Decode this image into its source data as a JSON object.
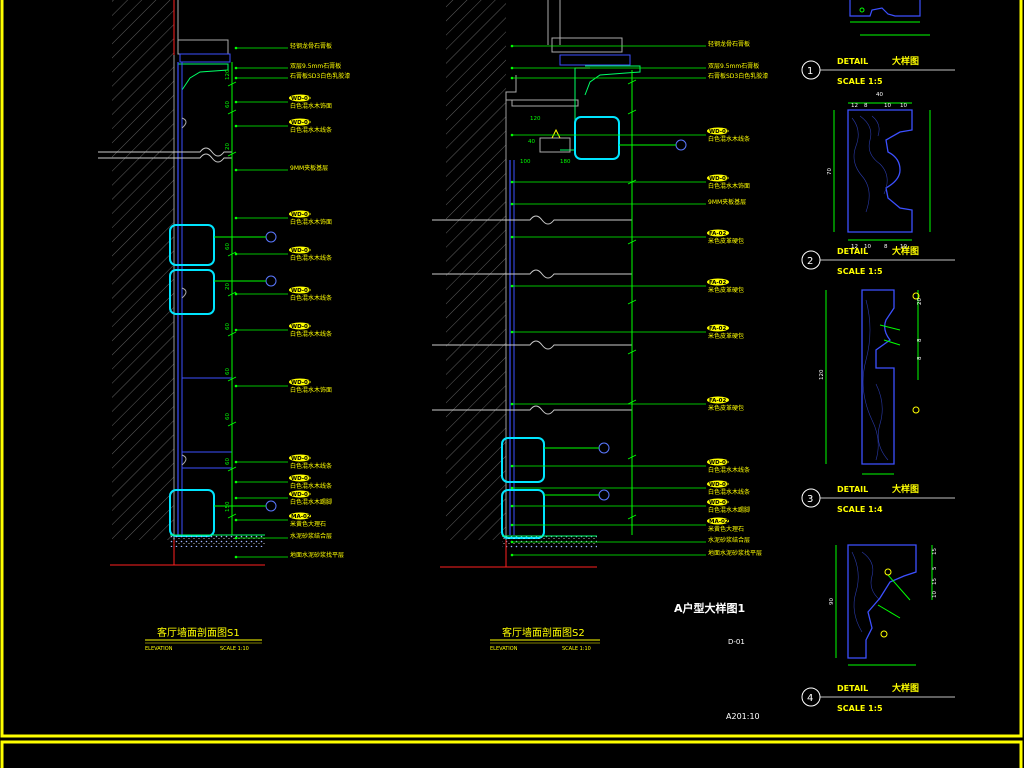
{
  "colors": {
    "frame": "#ffff00",
    "wall_hatch": "#9a9a9a",
    "leader": "#00ff00",
    "dimension": "#00ff00",
    "panel_line": "#3c50ff",
    "highlight_box": "#00e5ff",
    "callout_fill": "#ffff00",
    "label_text": "#ffff00",
    "title_text": "#ffff00",
    "note_text": "#ffffff",
    "floor_line": "#ff2020",
    "detail_circle": "#ffffff"
  },
  "section1": {
    "title": "客厅墙面剖面图S1",
    "elevation_label": "ELEVATION",
    "scale_label": "SCALE 1:10",
    "notes": [
      {
        "text": "轻钢龙骨石膏板"
      },
      {
        "text": "双层9.5mm石膏板"
      },
      {
        "text": "石膏板SD3白色乳胶漆"
      },
      {
        "tag": "WD-01",
        "text": "白色混水木饰面"
      },
      {
        "tag": "WD-01",
        "text": "白色混水木线条"
      },
      {
        "text": "9MM夹板基层"
      },
      {
        "tag": "WD-01",
        "text": "白色混水木饰面"
      },
      {
        "tag": "WD-01",
        "text": "白色混水木线条"
      },
      {
        "tag": "WD-01",
        "text": "白色混水木线条"
      },
      {
        "tag": "WD-01",
        "text": "白色混水木线条"
      },
      {
        "tag": "WD-01",
        "text": "白色混水木饰面"
      },
      {
        "tag": "WD-01",
        "text": "白色混水木线条"
      },
      {
        "tag": "WD-01",
        "text": "白色混水木线条"
      },
      {
        "tag": "WD-01",
        "text": "白色混水木踢脚"
      },
      {
        "tag": "MA-02",
        "text": "米黄色大理石"
      },
      {
        "text": "水泥砂浆结合层"
      },
      {
        "text": "地面水泥砂浆找平层"
      }
    ],
    "dims": [
      "120",
      "60",
      "20",
      "60",
      "20",
      "60",
      "60",
      "60",
      "60",
      "150"
    ]
  },
  "section2": {
    "title": "客厅墙面剖面图S2",
    "elevation_label": "ELEVATION",
    "scale_label": "SCALE 1:10",
    "notes": [
      {
        "text": "轻钢龙骨石膏板"
      },
      {
        "text": "双层9.5mm石膏板"
      },
      {
        "text": "石膏板SD3白色乳胶漆"
      },
      {
        "tag": "WD-01",
        "text": "白色混水木线条"
      },
      {
        "tag": "WD-01",
        "text": "白色混水木饰面"
      },
      {
        "text": "9MM夹板基层"
      },
      {
        "tag": "FA-02",
        "text": "米色皮革硬包"
      },
      {
        "tag": "FA-02",
        "text": "米色皮革硬包"
      },
      {
        "tag": "FA-02",
        "text": "米色皮革硬包"
      },
      {
        "tag": "FA-02",
        "text": "米色皮革硬包"
      },
      {
        "tag": "WD-01",
        "text": "白色混水木线条"
      },
      {
        "tag": "WD-01",
        "text": "白色混水木线条"
      },
      {
        "tag": "WD-01",
        "text": "白色混水木踢脚"
      },
      {
        "tag": "MA-02",
        "text": "米黄色大理石"
      },
      {
        "text": "水泥砂浆结合层"
      },
      {
        "text": "地面水泥砂浆找平层"
      }
    ],
    "dims_top": [
      "100",
      "180",
      "120",
      "40"
    ]
  },
  "sheet": {
    "title": "A户型大样图1",
    "sheet_no": "D-01",
    "drawing_no": "A201:10"
  },
  "details": [
    {
      "number": "1",
      "label": "DETAIL",
      "cn": "大样图",
      "scale": "SCALE 1:5"
    },
    {
      "number": "2",
      "label": "DETAIL",
      "cn": "大样图",
      "scale": "SCALE 1:5"
    },
    {
      "number": "3",
      "label": "DETAIL",
      "cn": "大样图",
      "scale": "SCALE 1:4"
    },
    {
      "number": "4",
      "label": "DETAIL",
      "cn": "大样图",
      "scale": "SCALE 1:5"
    }
  ],
  "detail_dims": {
    "d1_top": [
      "12",
      "8",
      "10",
      "10"
    ],
    "d1_top_total": "40",
    "d1_bottom": [
      "12",
      "10",
      "8",
      "10"
    ],
    "d1_left": "70",
    "d2_right": [
      "20",
      "8",
      "8"
    ],
    "d2_left": "120",
    "d3_right": [
      "15",
      "5",
      "15",
      "10"
    ],
    "d3_left": "90"
  }
}
